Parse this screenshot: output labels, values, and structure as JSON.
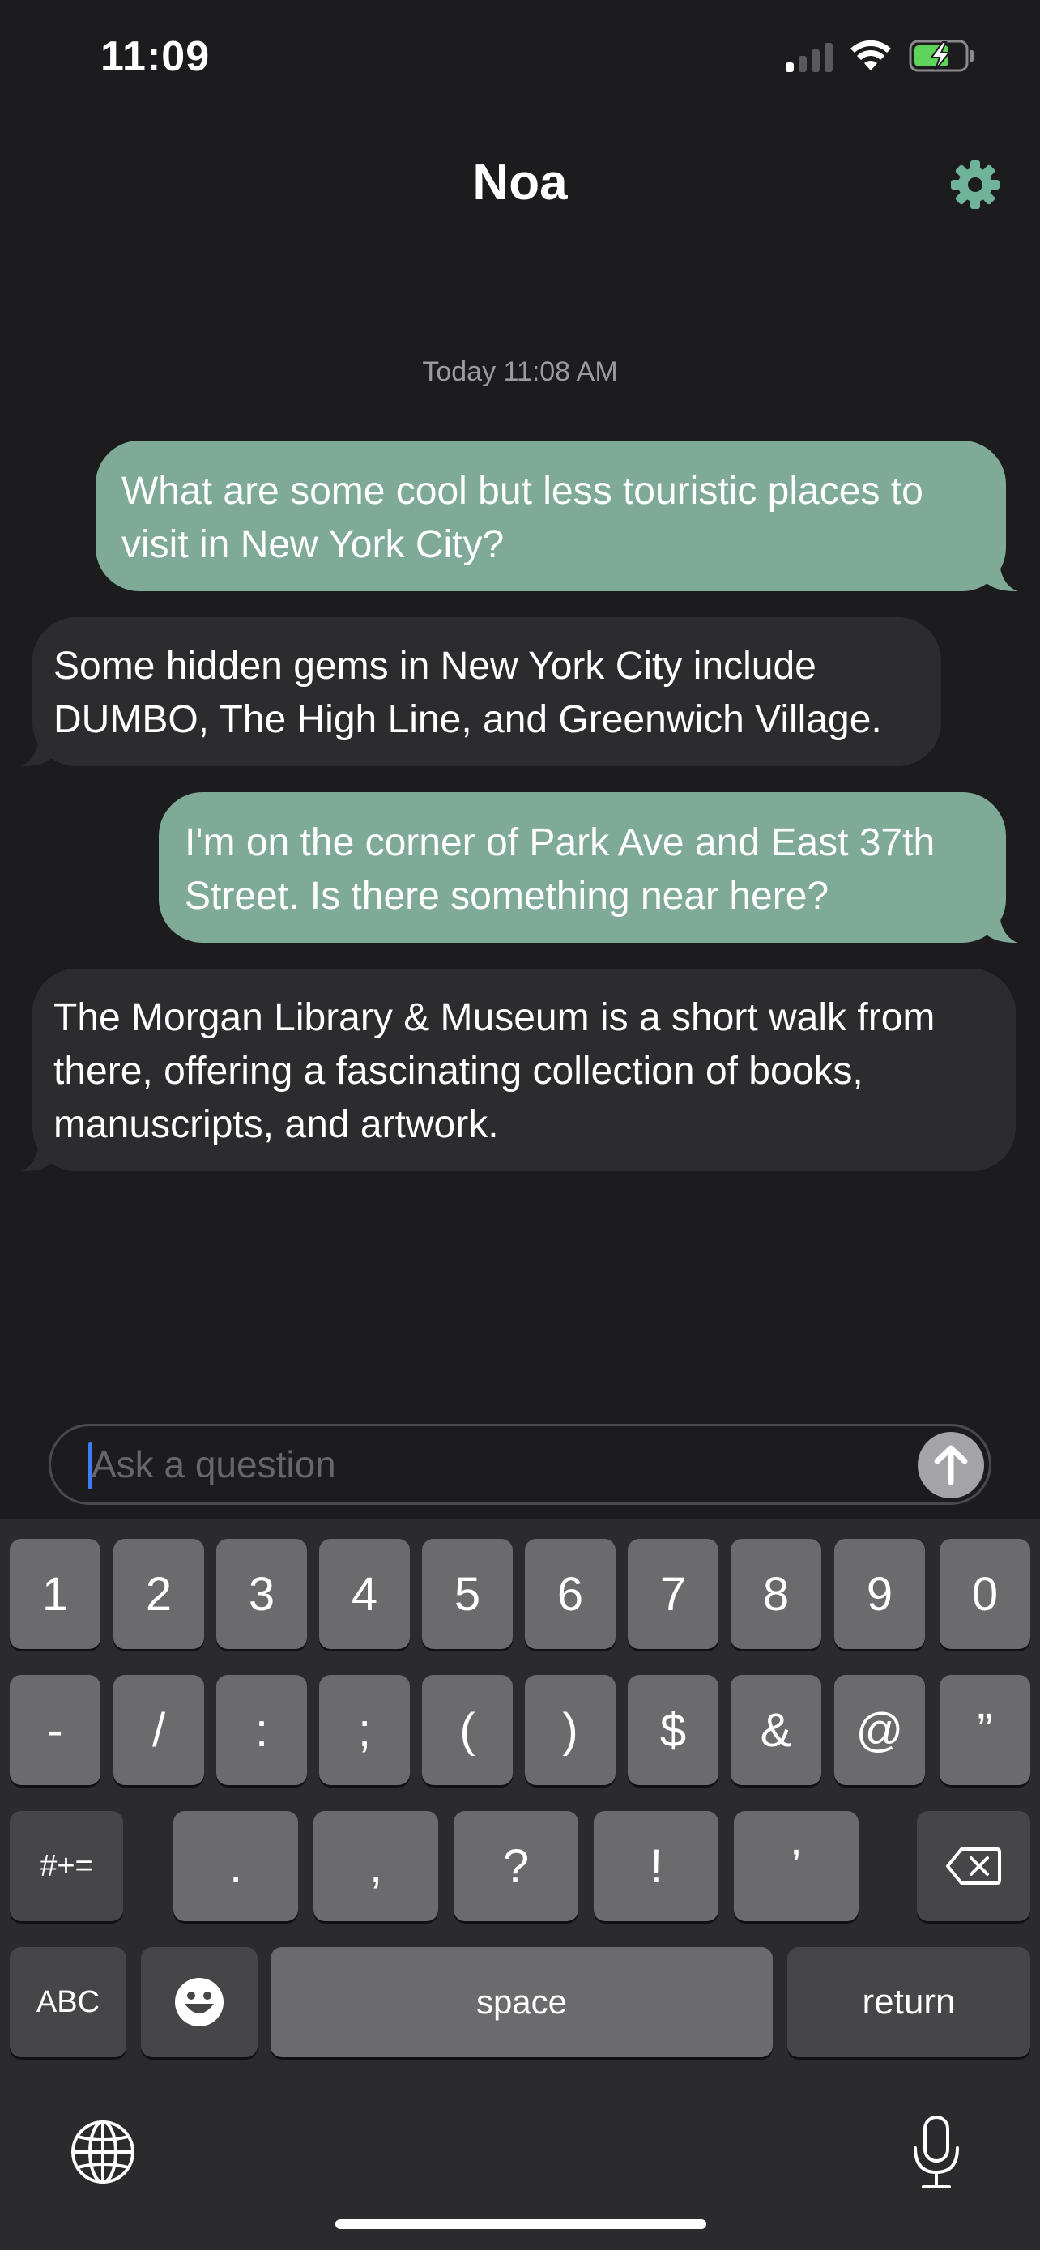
{
  "status_bar": {
    "time": "11:09"
  },
  "header": {
    "title": "Noa"
  },
  "chat": {
    "date_separator": "Today 11:08 AM",
    "messages": [
      {
        "role": "user",
        "text": "What are some cool but less touristic places to visit in New York City?"
      },
      {
        "role": "assistant",
        "text": "Some hidden gems in New York City include DUMBO, The High Line, and Greenwich Village."
      },
      {
        "role": "user",
        "text": "I'm on the corner of Park Ave and East 37th Street. Is there something near here?"
      },
      {
        "role": "assistant",
        "text": "The Morgan Library & Museum is a short walk from there, offering a fascinating collection of books, manuscripts, and artwork."
      }
    ]
  },
  "composer": {
    "placeholder": "Ask a question",
    "value": ""
  },
  "keyboard": {
    "row1": [
      "1",
      "2",
      "3",
      "4",
      "5",
      "6",
      "7",
      "8",
      "9",
      "0"
    ],
    "row2": [
      "-",
      "/",
      ":",
      ";",
      "(",
      ")",
      "$",
      "&",
      "@",
      "”"
    ],
    "row3": [
      "#+=",
      ".",
      ",",
      "?",
      "!",
      "’"
    ],
    "row4": {
      "abc": "ABC",
      "space": "space",
      "return": "return"
    }
  },
  "colors": {
    "user_bubble": "#7faa98",
    "assistant_bubble": "#2c2c2e",
    "accent": "#6fb39a",
    "background": "#1c1c1e"
  }
}
